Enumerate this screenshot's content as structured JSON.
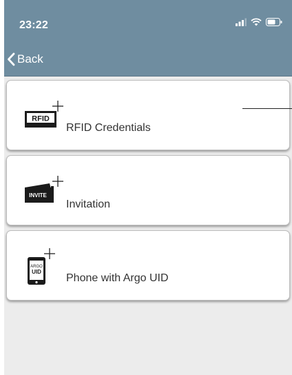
{
  "status_bar": {
    "time": "23:22"
  },
  "nav": {
    "back_label": "Back"
  },
  "items": [
    {
      "badge": "RFID",
      "label": "RFID Credentials"
    },
    {
      "badge": "INVITE",
      "label": "Invitation"
    },
    {
      "badge_line1": "ARGO",
      "badge_line2": "UID",
      "label": "Phone with Argo UID"
    }
  ],
  "colors": {
    "header": "#6f8da0",
    "background": "#ececec",
    "card": "#ffffff"
  },
  "icons": [
    "signal-icon",
    "wifi-icon",
    "battery-icon",
    "chevron-left-icon",
    "rfid-card-icon",
    "invite-card-icon",
    "phone-uid-icon",
    "plus-icon"
  ]
}
